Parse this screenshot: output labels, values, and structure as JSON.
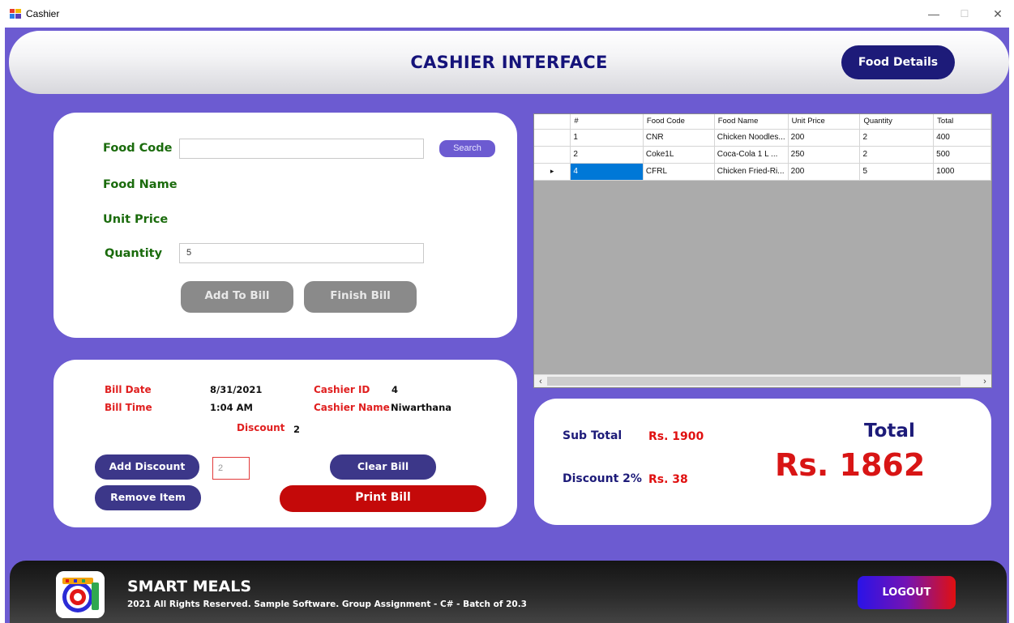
{
  "window": {
    "title": "Cashier",
    "minimize": "—",
    "maximize": "☐",
    "close": "✕"
  },
  "header": {
    "title": "CASHIER INTERFACE",
    "food_details_label": "Food Details"
  },
  "food_form": {
    "food_code_label": "Food Code",
    "food_code_value": "",
    "search_label": "Search",
    "food_name_label": "Food Name",
    "unit_price_label": "Unit Price",
    "quantity_label": "Quantity",
    "quantity_value": "5",
    "add_to_bill_label": "Add To Bill",
    "finish_bill_label": "Finish Bill"
  },
  "bill_info": {
    "bill_date_label": "Bill Date",
    "bill_date_value": "8/31/2021",
    "bill_time_label": "Bill Time",
    "bill_time_value": "1:04 AM",
    "cashier_id_label": "Cashier ID",
    "cashier_id_value": "4",
    "cashier_name_label": "Cashier Name",
    "cashier_name_value": "Niwarthana",
    "discount_label": "Discount",
    "discount_value": "2",
    "add_discount_label": "Add Discount",
    "discount_input_value": "2",
    "clear_bill_label": "Clear Bill",
    "remove_item_label": "Remove Item",
    "print_bill_label": "Print Bill"
  },
  "grid": {
    "columns": [
      "#",
      "Food Code",
      "Food Name",
      "Unit Price",
      "Quantity",
      "Total"
    ],
    "rows": [
      [
        "1",
        "CNR",
        "Chicken Noodles...",
        "200",
        "2",
        "400"
      ],
      [
        "2",
        "Coke1L",
        "Coca-Cola 1 L   ...",
        "250",
        "2",
        "500"
      ],
      [
        "4",
        "CFRL",
        "Chicken Fried-Ri...",
        "200",
        "5",
        "1000"
      ]
    ],
    "current_row_marker": "▸",
    "scroll_left": "‹",
    "scroll_right": "›"
  },
  "totals": {
    "sub_total_label": "Sub Total",
    "sub_total_value": "Rs. 1900",
    "discount_label": "Discount 2%",
    "discount_value": "Rs. 38",
    "total_label": "Total",
    "total_value": "Rs. 1862"
  },
  "footer": {
    "brand": "SMART MEALS",
    "copyright": "2021 All Rights Reserved.  Sample Software. Group Assignment - C# - Batch of 20.3",
    "logout_label": "LOGOUT"
  },
  "colors": {
    "background": "#6c5bd1",
    "navy": "#1d1b79",
    "green_label": "#1a6b0c",
    "red_label": "#e02020",
    "print_button": "#c40909",
    "selection": "#0078d7"
  }
}
